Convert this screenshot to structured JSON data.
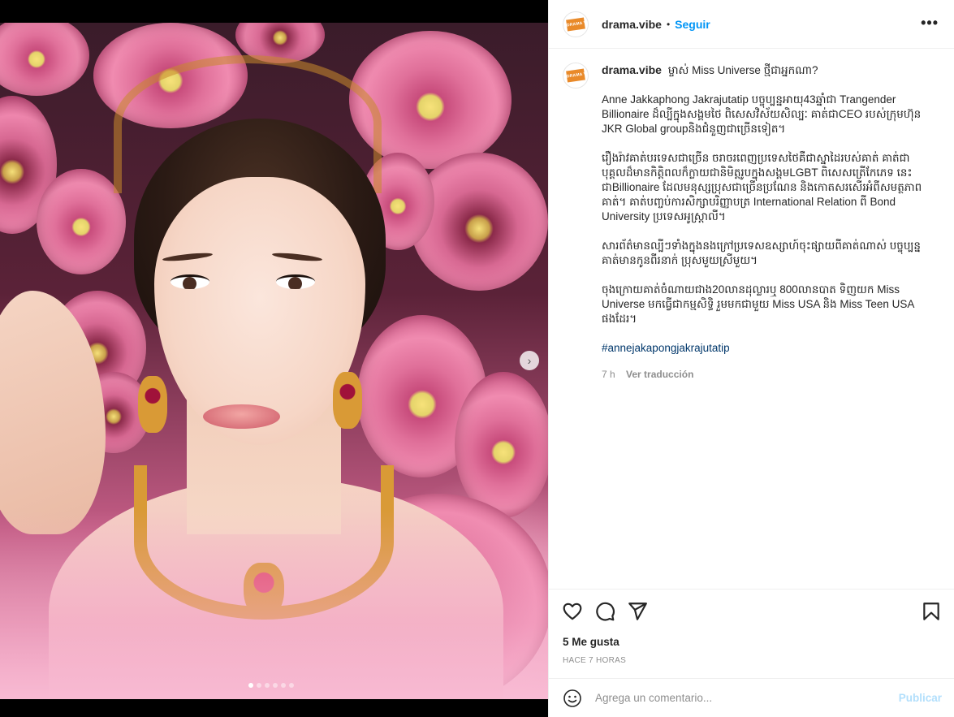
{
  "header": {
    "username": "drama.vibe",
    "separator": "•",
    "follow_label": "Seguir",
    "more_icon": "more-horizontal-icon",
    "more_label": "•••"
  },
  "media": {
    "next_label": "›",
    "slide_count": 6,
    "active_slide": 1
  },
  "caption": {
    "username": "drama.vibe",
    "avatar_text": "DRAMA VIBE",
    "title": "ម្ចាស់ Miss Universe ថ្មីជាអ្នកណា?",
    "paragraphs": [
      "Anne Jakkaphong Jakrajutatip បច្ចុប្បន្នអាយុ43ឆ្នាំជា Trangender Billionaire ដ៏ល្បីក្នុងសង្គមថៃ ពិសេសវិស័យសិល្បៈ គាត់ជាCEO របស់ក្រុមហ៊ុន JKR Global groupនិងជំនួញជាច្រើនទៀត។",
      "រឿងរ៉ាវគាត់បរទេសជាច្រើន ចរាចរពេញប្រទេសថៃគឺជាស្នាដៃរបស់គាត់ គាត់ជាបុគ្គលដ៏មានកិត្តិពលក៏ក្លាយជានិមិត្តរូបក្នុងសង្គមLGBT ពិសេសត្រើកែភេទ នេះជាBillionaire ដែលមនុស្សប្រុសជាច្រើនប្រណែន និងកោតសរសើរអំពីសមត្ថភាពគាត់។ គាត់បញ្ចប់ការសិក្សាបរិញ្ញាបត្រ International Relation ពី Bond University ប្រទេសអូស្ត្រាលី។",
      "សារព័ត៌មានល្បីៗទាំងក្នុងនងក្រៅប្រទេសឧស្សាហ៍ចុះផ្សាយពីគាត់ណាស់ បច្ចុប្បន្នគាត់មានកូនពីរនាក់ ប្រុសមួយស្រីមួយ។",
      "ចុងក្រោយគាត់ចំណាយជាង20លានដុល្លារឬ 800លានបាត ទិញយក Miss Universe មកធ្វើជាកម្មសិទ្ធិ រួមមកជាមួយ Miss USA និង Miss Teen USA ផងដែរ។"
    ],
    "hashtag": "#annejakapongjakrajutatip",
    "time": "7 h",
    "translate_label": "Ver traducción"
  },
  "actions": {
    "likes": "5 Me gusta",
    "time_ago": "HACE 7 HORAS"
  },
  "add_comment": {
    "placeholder": "Agrega un comentario...",
    "post_label": "Publicar"
  },
  "colors": {
    "accent": "#0095f6",
    "post_disabled": "#b2dffc",
    "hashtag": "#00376b",
    "muted": "#8e8e8e",
    "avatar_brand": "#e98a2a"
  }
}
